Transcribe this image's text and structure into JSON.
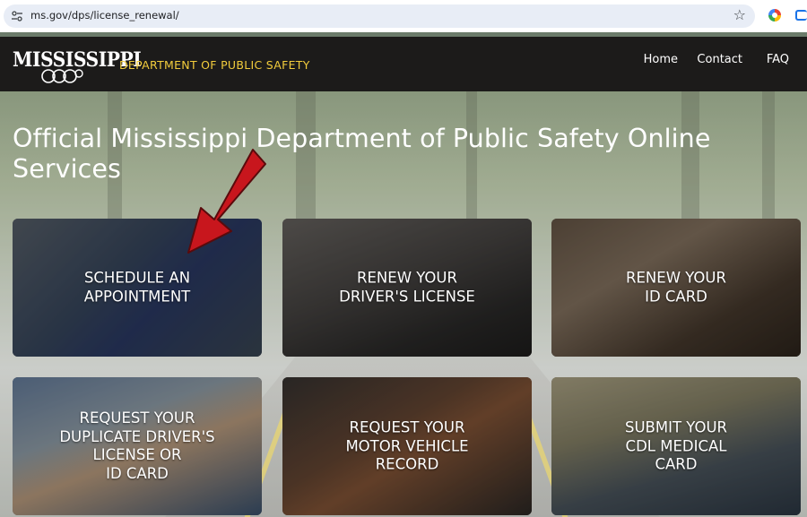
{
  "browser": {
    "url": "ms.gov/dps/license_renewal/",
    "star_icon": "star-icon"
  },
  "header": {
    "logo_text": "MISSISSIPPI",
    "department": "DEPARTMENT OF PUBLIC SAFETY",
    "nav": {
      "home": "Home",
      "contact": "Contact",
      "faq": "FAQ"
    }
  },
  "main": {
    "title": "Official Mississippi Department of Public Safety Online Services",
    "cards": [
      {
        "lines": [
          "SCHEDULE AN",
          "APPOINTMENT"
        ]
      },
      {
        "lines": [
          "RENEW YOUR",
          "DRIVER'S LICENSE"
        ]
      },
      {
        "lines": [
          "RENEW YOUR",
          "ID CARD"
        ]
      },
      {
        "lines": [
          "REQUEST YOUR",
          "DUPLICATE DRIVER'S",
          "LICENSE OR",
          "ID CARD"
        ]
      },
      {
        "lines": [
          "REQUEST YOUR",
          "MOTOR VEHICLE",
          "RECORD"
        ]
      },
      {
        "lines": [
          "SUBMIT YOUR",
          "CDL MEDICAL",
          "CARD"
        ]
      }
    ]
  },
  "colors": {
    "header_bg": "#1c1b1a",
    "department_text": "#f2cc3c",
    "annotation_arrow": "#c8161d"
  }
}
